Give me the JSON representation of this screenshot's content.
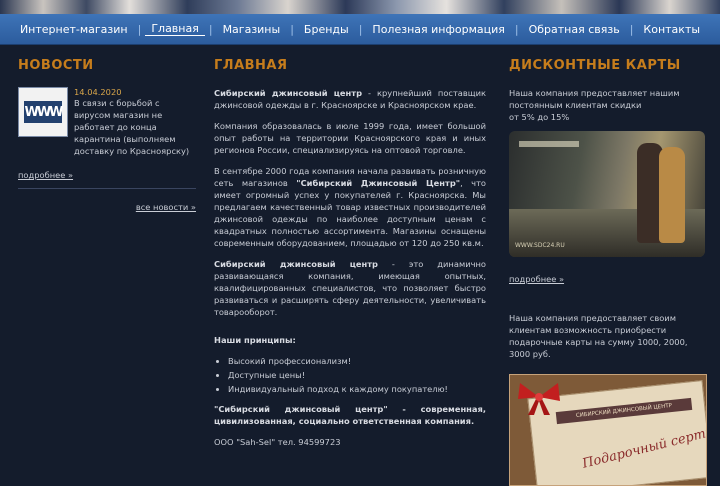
{
  "nav": {
    "items": [
      {
        "label": "Интернет-магазин",
        "active": false
      },
      {
        "label": "Главная",
        "active": true
      },
      {
        "label": "Магазины",
        "active": false
      },
      {
        "label": "Бренды",
        "active": false
      },
      {
        "label": "Полезная информация",
        "active": false
      },
      {
        "label": "Обратная связь",
        "active": false
      },
      {
        "label": "Контакты",
        "active": false
      }
    ]
  },
  "news": {
    "title": "НОВОСТИ",
    "thumb_text": "WWW",
    "date": "14.04.2020",
    "text": "В связи с борьбой с вирусом магазин не работает до конца карантина (выполняем доставку по Красноярску)",
    "more": "подробнее »",
    "all": "все новости »"
  },
  "main": {
    "title": "ГЛАВНАЯ",
    "p1_bold": "Сибирский джинсовый центр",
    "p1_rest": " - крупнейший поставщик джинсовой одежды в г. Красноярске и Красноярском крае.",
    "p2": "Компания образовалась в июле 1999 года, имеет большой опыт работы на территории Красноярского края и иных регионов России, специализируясь на оптовой торговле.",
    "p3_a": "В сентябре 2000 года компания начала развивать розничную сеть магазинов ",
    "p3_bold": "\"Сибирский Джинсовый Центр\"",
    "p3_b": ", что имеет огромный успех у покупателей г. Красноярска. Мы предлагаем качественный товар известных производителей джинсовой одежды по наиболее доступным ценам с квадратных полностью ассортимента. Магазины оснащены современным оборудованием, площадью от 120 до 250 кв.м.",
    "p4_bold": "Сибирский джинсовый центр",
    "p4_rest": " - это динамично развивающаяся компания, имеющая опытных, квалифицированных специалистов, что позволяет быстро развиваться и расширять сферу деятельности, увеличивать товарооборот.",
    "principles_title": "Наши принципы:",
    "principles": [
      "Высокий профессионализм!",
      "Доступные цены!",
      "Индивидуальный подход к каждому покупателю!"
    ],
    "closing_bold": "\"Сибирский джинсовый центр\" - современная, цивилизованная, социально ответственная компания.",
    "footer_line": "ООО \"Sah-Sel\" тел. 94599723"
  },
  "cards": {
    "title": "ДИСКОНТНЫЕ КАРТЫ",
    "text1": "Наша компания предоставляет нашим постоянным клиентам скидки",
    "text1b": "от 5% до 15%",
    "photo_caption": "WWW.SDC24.RU",
    "more": "подробнее »",
    "text2": "Наша компания предоставляет своим клиентам возможность приобрести подарочные карты на сумму 1000, 2000, 3000 руб.",
    "gift_band": "СИБИРСКИЙ ДЖИНСОВЫЙ ЦЕНТР",
    "gift_script": "Подарочный сертификат"
  }
}
